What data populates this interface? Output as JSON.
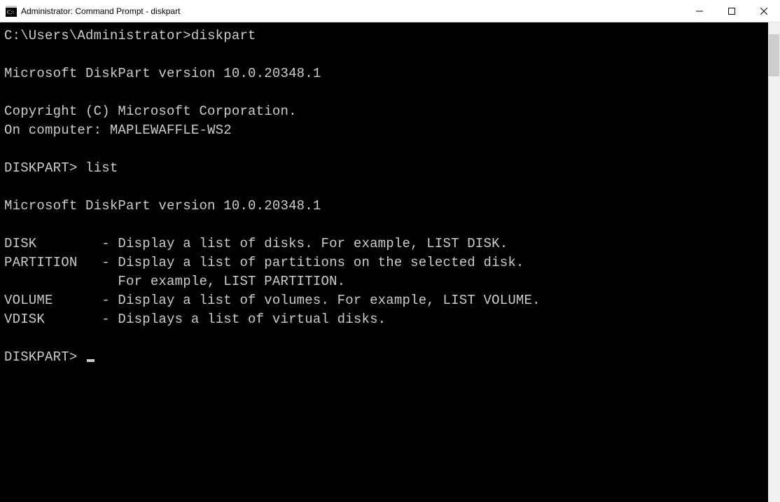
{
  "titlebar": {
    "text": "Administrator: Command Prompt - diskpart"
  },
  "console": {
    "prompt1_path": "C:\\Users\\Administrator>",
    "prompt1_cmd": "diskpart",
    "version_line": "Microsoft DiskPart version 10.0.20348.1",
    "copyright_line": "Copyright (C) Microsoft Corporation.",
    "computer_line": "On computer: MAPLEWAFFLE-WS2",
    "dp_prompt": "DISKPART> ",
    "dp_cmd": "list",
    "help_disk": "DISK        - Display a list of disks. For example, LIST DISK.",
    "help_partition": "PARTITION   - Display a list of partitions on the selected disk.",
    "help_partition2": "              For example, LIST PARTITION.",
    "help_volume": "VOLUME      - Display a list of volumes. For example, LIST VOLUME.",
    "help_vdisk": "VDISK       - Displays a list of virtual disks."
  }
}
